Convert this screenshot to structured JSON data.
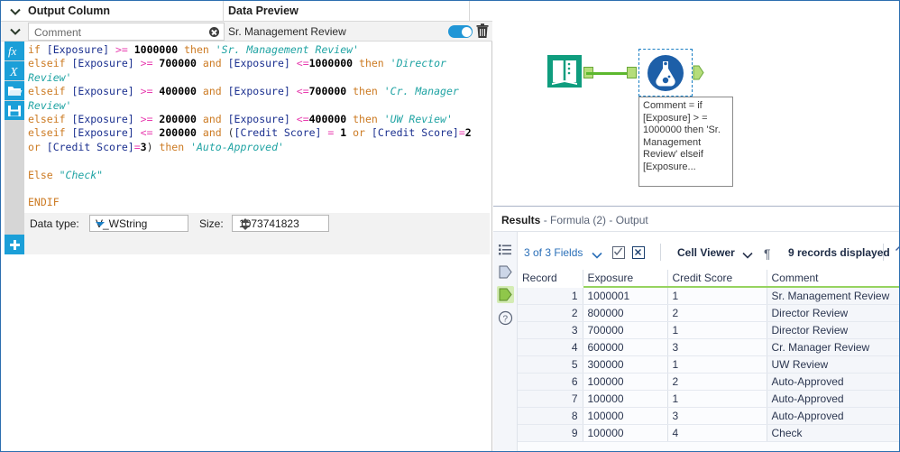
{
  "config_panel": {
    "header": {
      "output_column_label": "Output Column",
      "data_preview_label": "Data Preview"
    },
    "field_row": {
      "output_column_value": "Comment",
      "data_preview_value": "Sr. Management Review",
      "toggle_on": true,
      "clear_icon": "clear-circle-icon",
      "delete_icon": "trash-icon"
    },
    "rail_icons": [
      "fx-function-icon",
      "x-variable-icon",
      "open-folder-icon",
      "save-disk-icon"
    ],
    "formula_lines": [
      [
        {
          "t": "if ",
          "c": "kw"
        },
        {
          "t": "[Exposure] ",
          "c": "fld"
        },
        {
          "t": ">= ",
          "c": "op"
        },
        {
          "t": "1000000 ",
          "c": "num"
        },
        {
          "t": "then ",
          "c": "kw"
        },
        {
          "t": "'Sr. Management Review'",
          "c": "str"
        }
      ],
      [
        {
          "t": "elseif ",
          "c": "kw"
        },
        {
          "t": "[Exposure] ",
          "c": "fld"
        },
        {
          "t": ">= ",
          "c": "op"
        },
        {
          "t": "700000 ",
          "c": "num"
        },
        {
          "t": "and ",
          "c": "kw"
        },
        {
          "t": "[Exposure] ",
          "c": "fld"
        },
        {
          "t": "<=",
          "c": "op"
        },
        {
          "t": "1000000 ",
          "c": "num"
        },
        {
          "t": "then ",
          "c": "kw"
        },
        {
          "t": "'Director",
          "c": "str"
        }
      ],
      [
        {
          "t": "Review'",
          "c": "str"
        }
      ],
      [
        {
          "t": "elseif ",
          "c": "kw"
        },
        {
          "t": "[Exposure] ",
          "c": "fld"
        },
        {
          "t": ">= ",
          "c": "op"
        },
        {
          "t": "400000 ",
          "c": "num"
        },
        {
          "t": "and ",
          "c": "kw"
        },
        {
          "t": "[Exposure] ",
          "c": "fld"
        },
        {
          "t": "<=",
          "c": "op"
        },
        {
          "t": "700000 ",
          "c": "num"
        },
        {
          "t": "then ",
          "c": "kw"
        },
        {
          "t": "'Cr. Manager",
          "c": "str"
        }
      ],
      [
        {
          "t": "Review'",
          "c": "str"
        }
      ],
      [
        {
          "t": "elseif ",
          "c": "kw"
        },
        {
          "t": "[Exposure] ",
          "c": "fld"
        },
        {
          "t": ">= ",
          "c": "op"
        },
        {
          "t": "200000 ",
          "c": "num"
        },
        {
          "t": "and ",
          "c": "kw"
        },
        {
          "t": "[Exposure] ",
          "c": "fld"
        },
        {
          "t": "<=",
          "c": "op"
        },
        {
          "t": "400000 ",
          "c": "num"
        },
        {
          "t": "then ",
          "c": "kw"
        },
        {
          "t": "'UW Review'",
          "c": "str"
        }
      ],
      [
        {
          "t": "elseif ",
          "c": "kw"
        },
        {
          "t": "[Exposure] ",
          "c": "fld"
        },
        {
          "t": "<= ",
          "c": "op"
        },
        {
          "t": "200000 ",
          "c": "num"
        },
        {
          "t": "and ",
          "c": "kw"
        },
        {
          "t": "(",
          "c": "paren"
        },
        {
          "t": "[Credit Score] ",
          "c": "fld"
        },
        {
          "t": "= ",
          "c": "op"
        },
        {
          "t": "1 ",
          "c": "num"
        },
        {
          "t": "or ",
          "c": "kw"
        },
        {
          "t": "[Credit Score]",
          "c": "fld"
        },
        {
          "t": "=",
          "c": "op"
        },
        {
          "t": "2",
          "c": "num"
        }
      ],
      [
        {
          "t": "or ",
          "c": "kw"
        },
        {
          "t": "[Credit Score]",
          "c": "fld"
        },
        {
          "t": "=",
          "c": "op"
        },
        {
          "t": "3",
          "c": "num"
        },
        {
          "t": ") ",
          "c": "paren"
        },
        {
          "t": "then ",
          "c": "kw"
        },
        {
          "t": "'Auto-Approved'",
          "c": "str"
        }
      ],
      [],
      [
        {
          "t": "Else ",
          "c": "kw"
        },
        {
          "t": "\"Check\"",
          "c": "str"
        }
      ],
      [],
      [
        {
          "t": "ENDIF",
          "c": "kw"
        }
      ]
    ],
    "data_type": {
      "label": "Data type:",
      "value": "V_WString",
      "size_label": "Size:",
      "size_value": "1073741823"
    },
    "add_button_label": "+"
  },
  "canvas": {
    "input_tool_icon": "input-data-book-icon",
    "formula_tool_icon": "formula-flask-icon",
    "tooltip_text": "Comment = if [Exposure] > = 1000000 then 'Sr. Management Review' elseif [Exposure...",
    "connector_color": "#5cb82e"
  },
  "results": {
    "header_bold": "Results",
    "header_rest": " - Formula (2) - Output",
    "rail_icons": [
      "list-view-icon",
      "data-profile-icon",
      "output-anchor-icon",
      "help-circle-icon"
    ],
    "toolbar": {
      "fields_label": "3 of 3 Fields",
      "fields_chevron": "chevron-down-icon",
      "select_all_icon": "checkbox-icon",
      "deselect_icon": "x-box-icon",
      "cell_viewer_label": "Cell Viewer",
      "cell_viewer_chevron": "chevron-down-icon",
      "pilcrow_icon": "pilcrow-icon",
      "records_label": "9 records displayed",
      "up_arrow_icon": "arrow-up-icon"
    },
    "grid": {
      "columns": [
        "Record",
        "Exposure",
        "Credit Score",
        "Comment"
      ],
      "rows": [
        {
          "record": "1",
          "exposure": "1000001",
          "credit_score": "1",
          "comment": "Sr. Management Review"
        },
        {
          "record": "2",
          "exposure": "800000",
          "credit_score": "2",
          "comment": "Director Review"
        },
        {
          "record": "3",
          "exposure": "700000",
          "credit_score": "1",
          "comment": "Director Review"
        },
        {
          "record": "4",
          "exposure": "600000",
          "credit_score": "3",
          "comment": "Cr. Manager Review"
        },
        {
          "record": "5",
          "exposure": "300000",
          "credit_score": "1",
          "comment": "UW Review"
        },
        {
          "record": "6",
          "exposure": "100000",
          "credit_score": "2",
          "comment": "Auto-Approved"
        },
        {
          "record": "7",
          "exposure": "100000",
          "credit_score": "1",
          "comment": "Auto-Approved"
        },
        {
          "record": "8",
          "exposure": "100000",
          "credit_score": "3",
          "comment": "Auto-Approved"
        },
        {
          "record": "9",
          "exposure": "100000",
          "credit_score": "4",
          "comment": "Check"
        }
      ]
    }
  },
  "colors": {
    "accent_blue": "#1b9fd8",
    "green_connector": "#5cb82e",
    "header_green": "#96d35f",
    "tool_teal": "#0f9d7e",
    "tool_blue": "#1d5fa8"
  }
}
